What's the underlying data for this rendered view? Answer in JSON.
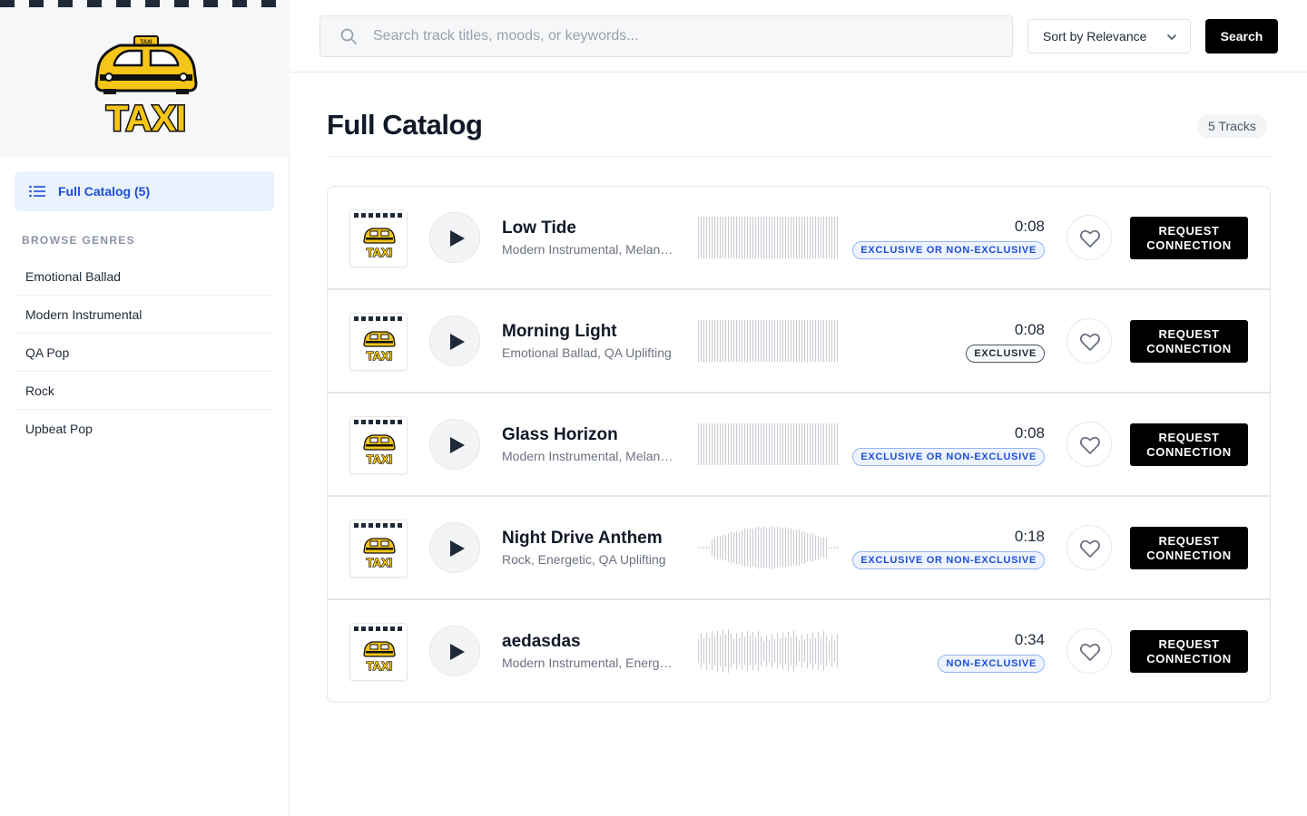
{
  "brand": {
    "logo_icon": "taxi-logo",
    "logo_text": "TAXI",
    "roof_sign": "TAXI"
  },
  "sidebar": {
    "active_item": {
      "label": "Full Catalog (5)",
      "icon": "list-icon"
    },
    "genres_heading": "BROWSE GENRES",
    "genres": [
      "Emotional Ballad",
      "Modern Instrumental",
      "QA Pop",
      "Rock",
      "Upbeat Pop"
    ]
  },
  "topbar": {
    "search_placeholder": "Search track titles, moods, or keywords...",
    "search_value": "",
    "sort_label": "Sort by Relevance",
    "search_button": "Search"
  },
  "main": {
    "title": "Full Catalog",
    "track_count": "5 Tracks",
    "request_label": "REQUEST CONNECTION",
    "tracks": [
      {
        "title": "Low Tide",
        "genres": "Modern Instrumental, Melancholic",
        "duration": "0:08",
        "license": "EXCLUSIVE OR NON-EXCLUSIVE",
        "license_style": "blue",
        "waveform": "flat"
      },
      {
        "title": "Morning Light",
        "genres": "Emotional Ballad, QA Uplifting",
        "duration": "0:08",
        "license": "EXCLUSIVE",
        "license_style": "gray",
        "waveform": "flat"
      },
      {
        "title": "Glass Horizon",
        "genres": "Modern Instrumental, Melancholic",
        "duration": "0:08",
        "license": "EXCLUSIVE OR NON-EXCLUSIVE",
        "license_style": "blue",
        "waveform": "flat"
      },
      {
        "title": "Night Drive Anthem",
        "genres": "Rock, Energetic, QA Uplifting",
        "duration": "0:18",
        "license": "EXCLUSIVE OR NON-EXCLUSIVE",
        "license_style": "blue",
        "waveform": "peaked"
      },
      {
        "title": "aedasdas",
        "genres": "Modern Instrumental, Energetic",
        "duration": "0:34",
        "license": "NON-EXCLUSIVE",
        "license_style": "blue",
        "waveform": "varied"
      }
    ]
  },
  "colors": {
    "accent_blue": "#1d4ed8",
    "active_bg": "#eaf2fe",
    "button_black": "#000000",
    "taxi_yellow": "#f5c518"
  }
}
